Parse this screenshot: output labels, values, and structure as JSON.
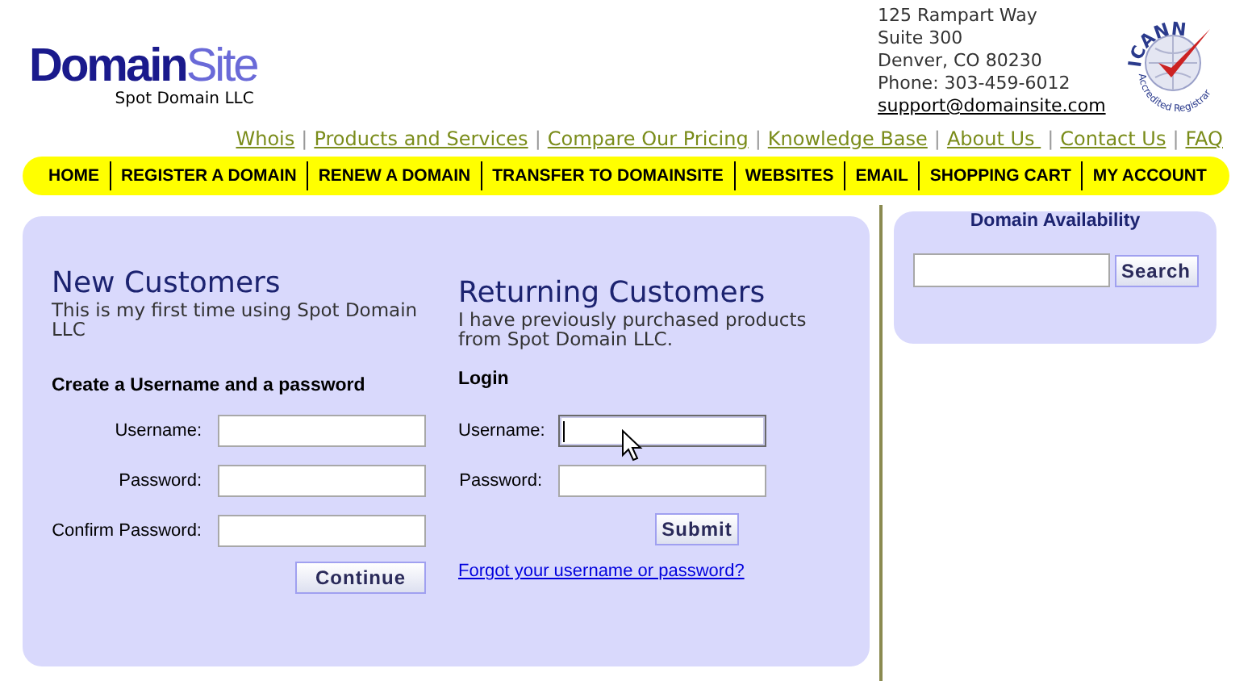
{
  "logo": {
    "name_first": "Domain",
    "name_second": "Site",
    "tagline": "Spot Domain LLC"
  },
  "address": {
    "lines": [
      "125 Rampart Way",
      "Suite 300",
      "Denver, CO 80230",
      "Phone: 303-459-6012"
    ],
    "email": "support@domainsite.com"
  },
  "seal": {
    "title": "ICANN",
    "subtitle": "Accredited Registrar"
  },
  "top_links": [
    {
      "label": "Whois"
    },
    {
      "label": "Products and Services",
      "separator": "|"
    },
    {
      "label": "Compare Our Pricing",
      "separator": "|"
    },
    {
      "label": "Knowledge Base",
      "separator": "|"
    },
    {
      "label": "About Us ",
      "separator": "|"
    },
    {
      "label": "Contact Us",
      "separator": "|"
    },
    {
      "label": "FAQ",
      "separator": "|"
    }
  ],
  "nav": [
    "HOME",
    "REGISTER A DOMAIN",
    "RENEW A DOMAIN",
    "TRANSFER TO DOMAINSITE",
    "WEBSITES",
    "EMAIL",
    "SHOPPING CART",
    "MY ACCOUNT"
  ],
  "new_customers": {
    "title": "New Customers",
    "subtitle": "This is my first time using Spot Domain LLC",
    "section": "Create a Username and a password",
    "fields": [
      {
        "label": "Username:",
        "focused": false
      },
      {
        "label": "Password:",
        "focused": false
      },
      {
        "label": "Confirm Password:",
        "focused": false
      }
    ],
    "button": "Continue"
  },
  "returning_customers": {
    "title": "Returning Customers",
    "subtitle": "I have previously purchased products from Spot Domain LLC.",
    "section": "Login",
    "fields": [
      {
        "label": "Username:",
        "focused": true
      },
      {
        "label": "Password:",
        "focused": false
      }
    ],
    "button": "Submit",
    "link": "Forgot your username or password?"
  },
  "domain_availability": {
    "title": "Domain Availability",
    "button": "Search"
  }
}
